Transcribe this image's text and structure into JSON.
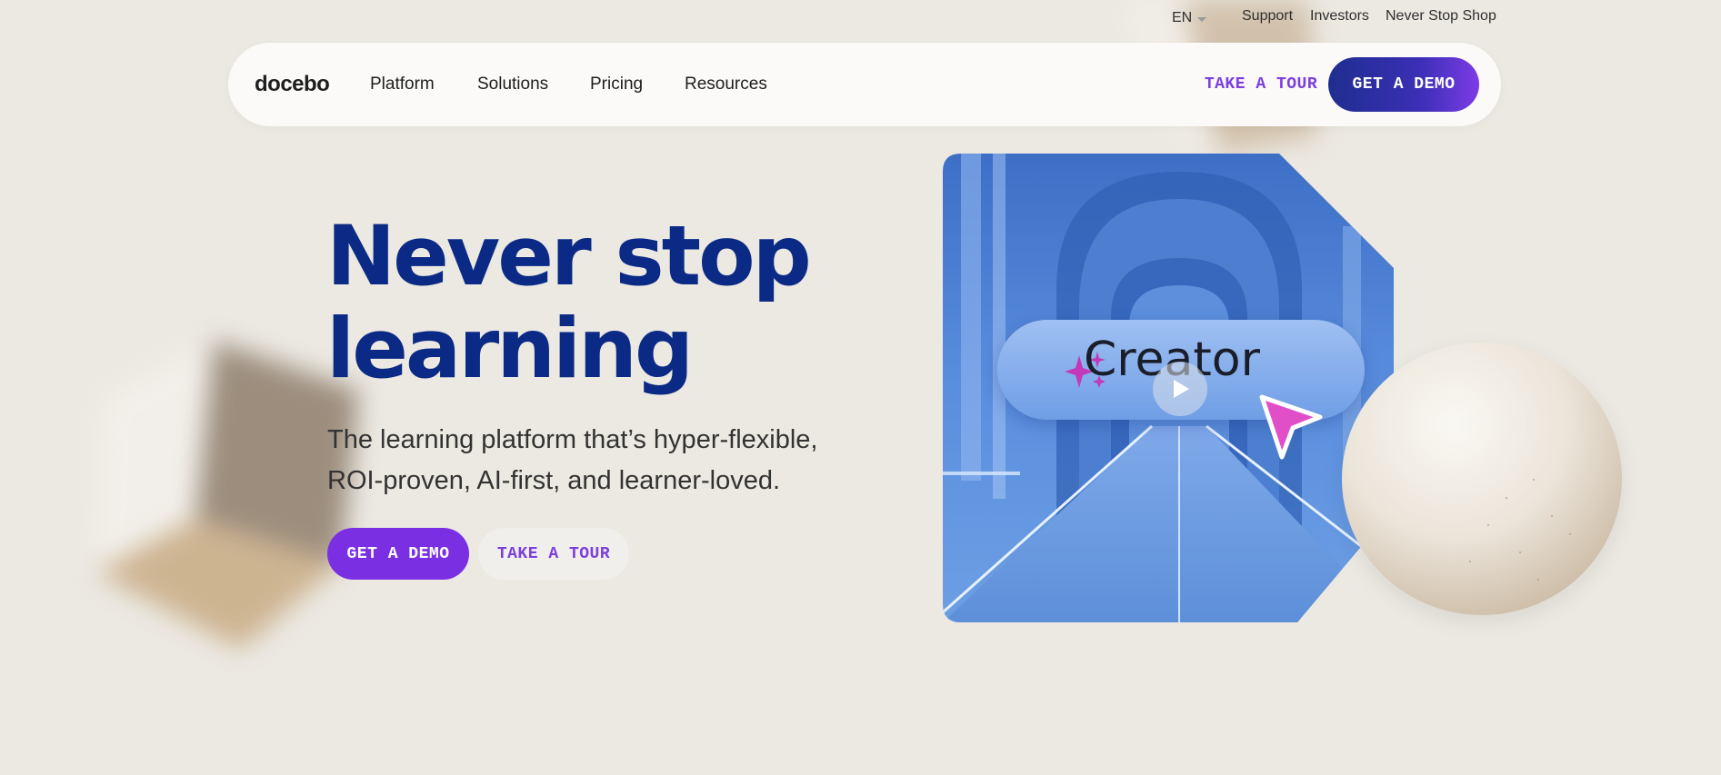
{
  "utility_bar": {
    "language": "EN",
    "links": [
      "Support",
      "Investors",
      "Never Stop Shop"
    ]
  },
  "nav": {
    "logo": "docebo",
    "items": [
      "Platform",
      "Solutions",
      "Pricing",
      "Resources"
    ],
    "tour_button": "TAKE A TOUR",
    "demo_button": "GET A DEMO"
  },
  "hero": {
    "headline_line1": "Never stop",
    "headline_line2": "learning",
    "subheadline_line1": "The learning platform that’s hyper-flexible,",
    "subheadline_line2": "ROI-proven, AI-first, and learner-loved.",
    "primary_button": "GET A DEMO",
    "secondary_button": "TAKE A TOUR"
  },
  "video": {
    "overlay_text": "Creator",
    "icons": [
      "sparkle-icon",
      "cursor-arrow-icon",
      "play-icon"
    ]
  },
  "colors": {
    "background": "#ece9e2",
    "headline": "#0b2a86",
    "accent_purple": "#7b2fe3",
    "nav_demo_start": "#1f2e8f",
    "nav_demo_end": "#7d3be6"
  }
}
